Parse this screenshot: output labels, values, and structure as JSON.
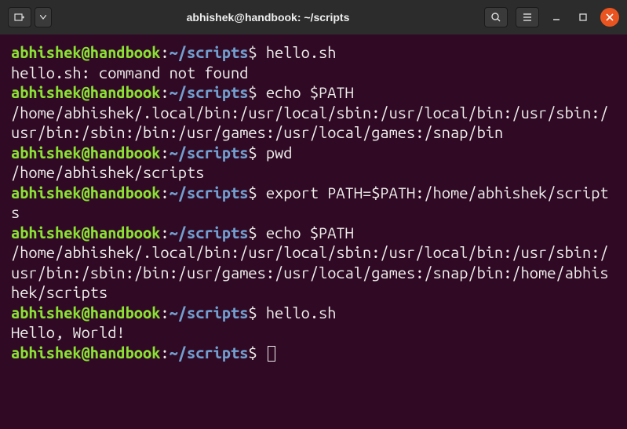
{
  "window": {
    "title": "abhishek@handbook: ~/scripts"
  },
  "prompt": {
    "user": "abhishek@handbook",
    "colon": ":",
    "path": "~/scripts",
    "dollar": "$"
  },
  "lines": [
    {
      "type": "prompt",
      "cmd": "hello.sh"
    },
    {
      "type": "output",
      "text": "hello.sh: command not found"
    },
    {
      "type": "prompt",
      "cmd": "echo $PATH"
    },
    {
      "type": "output",
      "text": "/home/abhishek/.local/bin:/usr/local/sbin:/usr/local/bin:/usr/sbin:/usr/bin:/sbin:/bin:/usr/games:/usr/local/games:/snap/bin"
    },
    {
      "type": "prompt",
      "cmd": "pwd"
    },
    {
      "type": "output",
      "text": "/home/abhishek/scripts"
    },
    {
      "type": "prompt",
      "cmd": "export PATH=$PATH:/home/abhishek/scripts"
    },
    {
      "type": "prompt",
      "cmd": "echo $PATH"
    },
    {
      "type": "output",
      "text": "/home/abhishek/.local/bin:/usr/local/sbin:/usr/local/bin:/usr/sbin:/usr/bin:/sbin:/bin:/usr/games:/usr/local/games:/snap/bin:/home/abhishek/scripts"
    },
    {
      "type": "prompt",
      "cmd": "hello.sh"
    },
    {
      "type": "output",
      "text": "Hello, World!"
    },
    {
      "type": "prompt",
      "cmd": "",
      "cursor": true
    }
  ]
}
